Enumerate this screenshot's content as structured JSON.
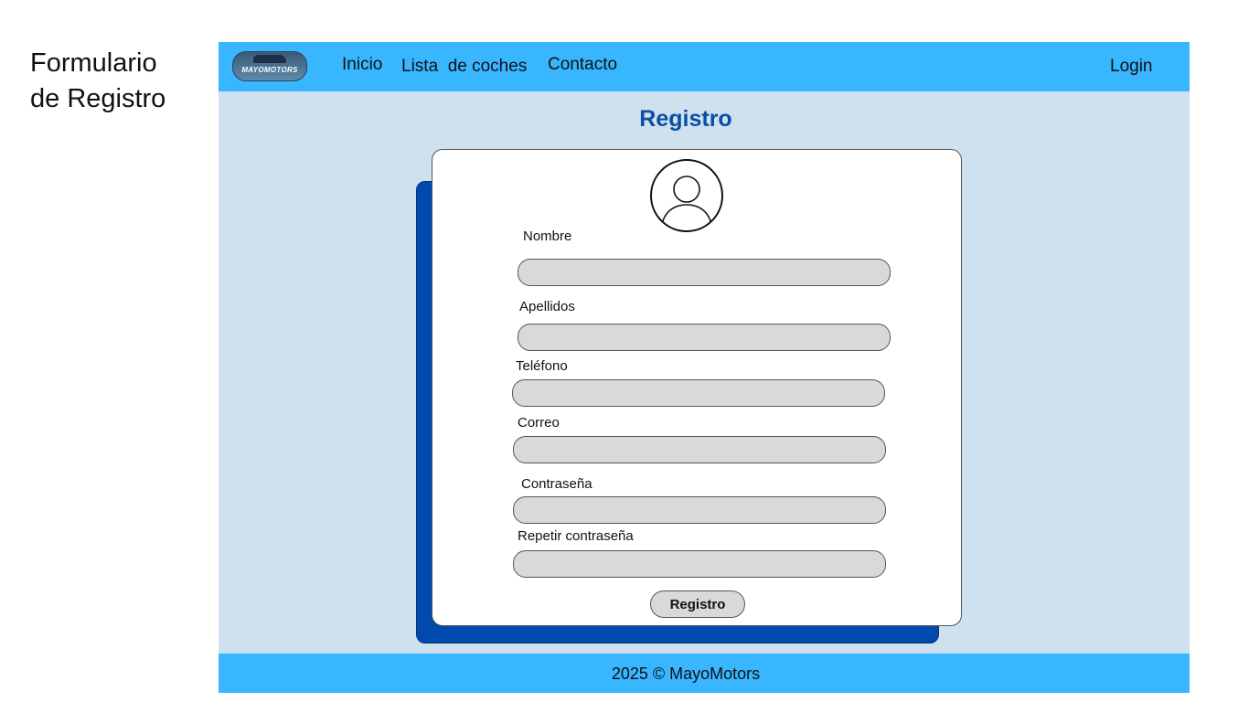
{
  "page": {
    "side_title": "Formulario\nde Registro"
  },
  "header": {
    "logo_text": "MAYOMOTORS",
    "nav": {
      "inicio": "Inicio",
      "lista": "Lista  de coches",
      "contacto": "Contacto",
      "login": "Login"
    }
  },
  "main": {
    "title": "Registro",
    "form": {
      "fields": {
        "nombre": {
          "label": "Nombre",
          "value": "",
          "placeholder": ""
        },
        "apellidos": {
          "label": "Apellidos",
          "value": "",
          "placeholder": ""
        },
        "telefono": {
          "label": "Teléfono",
          "value": "",
          "placeholder": ""
        },
        "correo": {
          "label": "Correo",
          "value": "",
          "placeholder": ""
        },
        "contrasena": {
          "label": "Contraseña",
          "value": "",
          "placeholder": ""
        },
        "repetir": {
          "label": "Repetir contraseña",
          "value": "",
          "placeholder": ""
        }
      },
      "submit_label": "Registro",
      "avatar_icon": "user-avatar-icon"
    }
  },
  "footer": {
    "text": "2025 © MayoMotors"
  },
  "colors": {
    "bar": "#38b6ff",
    "background": "#cfe0ef",
    "accent": "#004aad",
    "heading": "#0b4ea6",
    "field": "#d9d9d9"
  }
}
